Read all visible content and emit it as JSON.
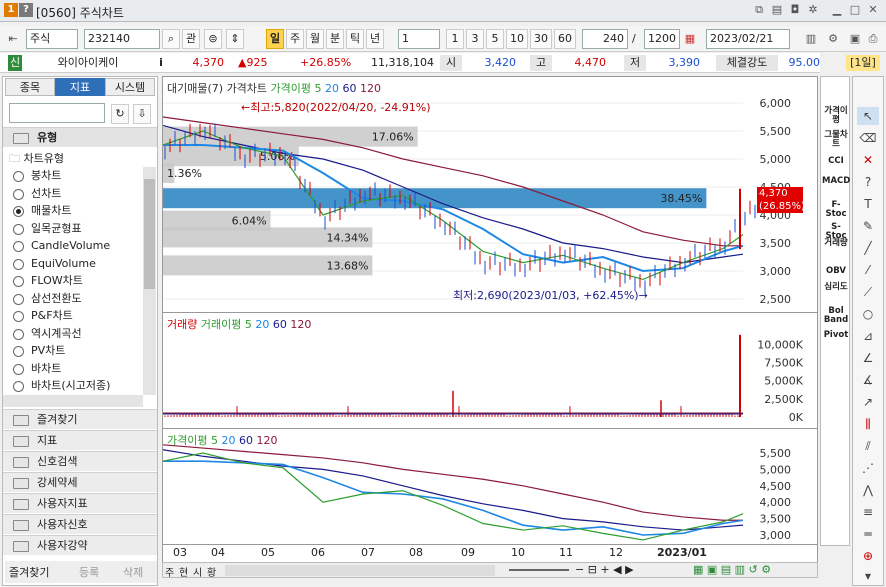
{
  "window": {
    "badge1": "1",
    "badge2": "?",
    "title": "[0560] 주식차트"
  },
  "toolbar": {
    "market": "주식",
    "code": "232140",
    "search_label": "관",
    "periods": [
      "일",
      "주",
      "월",
      "분",
      "틱",
      "년"
    ],
    "interval": "1",
    "intervals": [
      "1",
      "3",
      "5",
      "10",
      "30",
      "60"
    ],
    "count": "240",
    "total": "1200",
    "date": "2023/02/21"
  },
  "quote": {
    "credit": "신",
    "name": "와이아이케이",
    "info": "i",
    "price": "4,370",
    "change": "▲925",
    "rate": "+26.85%",
    "volume": "11,318,104",
    "open_label": "시",
    "open": "3,420",
    "high_label": "고",
    "high": "4,470",
    "low_label": "저",
    "low": "3,390",
    "strength_label": "체결강도",
    "strength": "95.00",
    "period": "[1일]"
  },
  "sidebar": {
    "tabs": [
      "종목",
      "지표",
      "시스템"
    ],
    "section": "유형",
    "group": "차트유형",
    "items": [
      "봉차트",
      "선차트",
      "매물차트",
      "일목균형표",
      "CandleVolume",
      "EquiVolume",
      "FLOW차트",
      "삼선전환도",
      "P&F차트",
      "역시계곡선",
      "PV차트",
      "바차트",
      "바차트(시고저종)"
    ],
    "selected": "매물차트",
    "folders": [
      "즐겨찾기",
      "지표",
      "신호검색",
      "강세약세",
      "사용자지표",
      "사용자신호",
      "사용자강약"
    ],
    "bottom_tabs": [
      "즐겨찾기",
      "등록",
      "삭제"
    ]
  },
  "chart": {
    "pane1_legend": [
      "대기매물(7)",
      "가격차트",
      "가격이평",
      "5",
      "20",
      "60",
      "120"
    ],
    "pane2_legend": [
      "거래량",
      "거래이평",
      "5",
      "20",
      "60",
      "120"
    ],
    "pane3_legend": [
      "가격이평",
      "5",
      "20",
      "60",
      "120"
    ],
    "high_note": "←최고:5,820(2022/04/20, -24.91%)",
    "low_note": "최저:2,690(2023/01/03, +62.45%)→",
    "price_tag": "4,370",
    "price_tag2": "(26.85%)",
    "profile_pcts": [
      "17.06%",
      "5.06%",
      "1.36%",
      "38.45%",
      "6.04%",
      "14.34%",
      "13.68%"
    ],
    "y1": [
      "6,000",
      "5,500",
      "5,000",
      "4,500",
      "4,000",
      "3,500",
      "3,000",
      "2,500"
    ],
    "y2": [
      "10,000K",
      "7,500K",
      "5,000K",
      "2,500K",
      "0K"
    ],
    "y3": [
      "5,500",
      "5,000",
      "4,500",
      "4,000",
      "3,500",
      "3,000"
    ],
    "x": [
      "03",
      "04",
      "05",
      "06",
      "07",
      "08",
      "09",
      "10",
      "11",
      "12",
      "2023/01"
    ],
    "bottom_nav": [
      "주",
      "현",
      "시",
      "황"
    ],
    "colors": {
      "ma5": "#2f9e2f",
      "ma20": "#1e88e5",
      "ma60": "#1a1a8c",
      "ma120": "#8b1a3a",
      "profile": "#c8c8c8",
      "profile_max": "#3b8ec6",
      "up": "#d40000"
    }
  },
  "indicators": [
    "가격이평",
    "그물차트",
    "CCI",
    "MACD",
    "F-Stoc",
    "S-Stoc",
    "거래량",
    "OBV",
    "심리도",
    "Bol Band",
    "Pivot"
  ]
}
